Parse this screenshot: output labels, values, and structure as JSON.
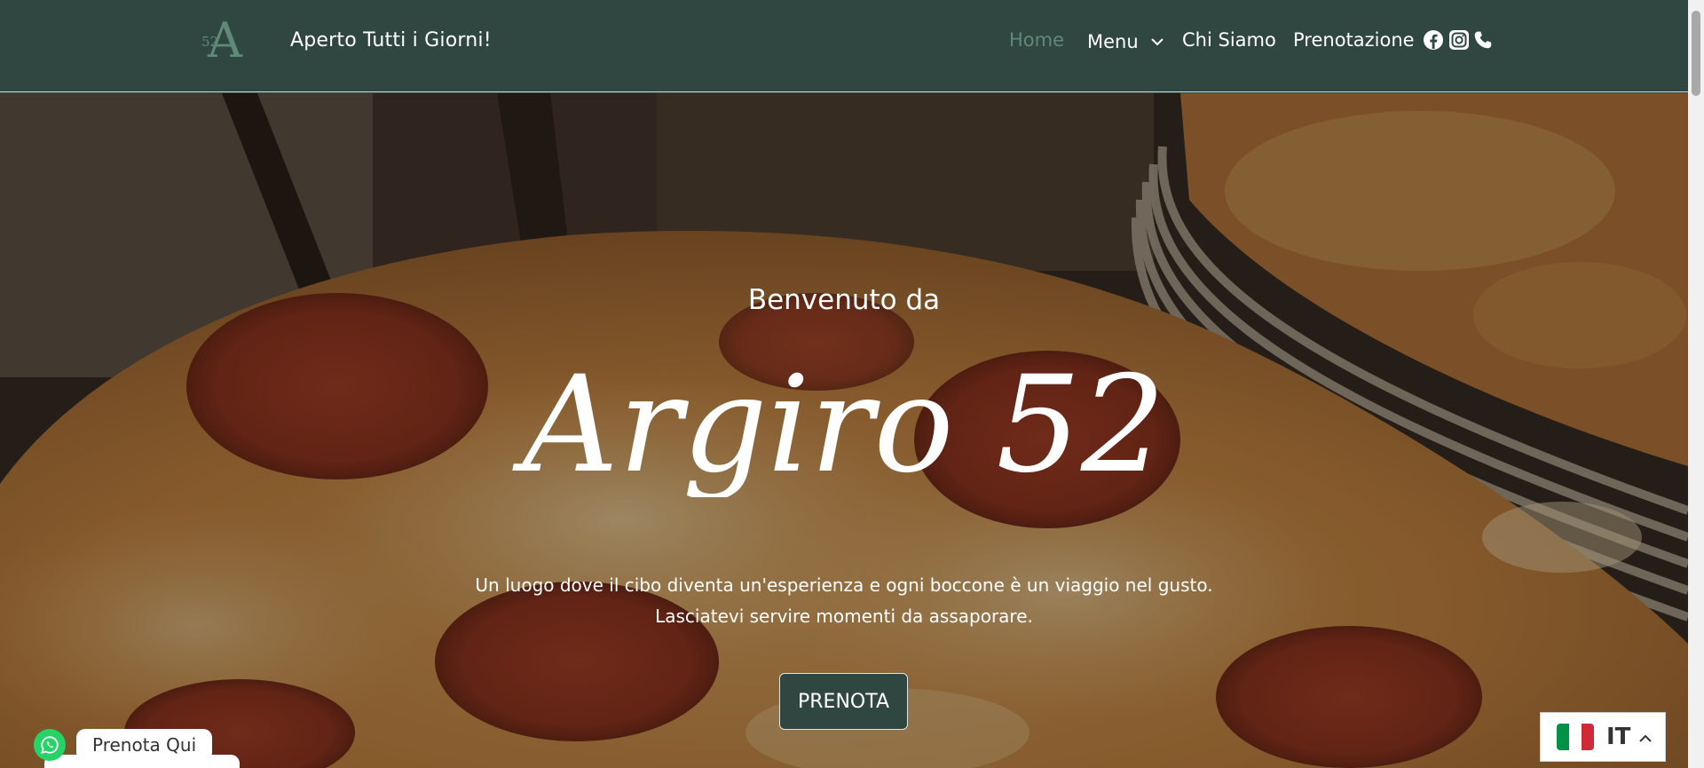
{
  "header": {
    "logo_letter": "A",
    "logo_number": "52",
    "tagline": "Aperto Tutti i Giorni!",
    "nav": [
      {
        "label": "Home",
        "active": true
      },
      {
        "label": "Menu",
        "has_dropdown": true
      },
      {
        "label": "Chi Siamo"
      },
      {
        "label": "Prenotazione"
      }
    ],
    "social_icons": [
      "facebook-icon",
      "instagram-icon",
      "phone-icon"
    ]
  },
  "hero": {
    "subtitle": "Benvenuto da",
    "title": "Argiro 52",
    "description": [
      "Un luogo dove il cibo diventa un'esperienza e ogni boccone è un viaggio nel gusto.",
      "Lasciatevi servire momenti da assaporare."
    ],
    "cta_label": "PRENOTA"
  },
  "whatsapp": {
    "label": "Prenota Qui"
  },
  "language": {
    "code": "IT",
    "flag_colors": [
      "#009246",
      "#ffffff",
      "#ce2b37"
    ]
  },
  "colors": {
    "brand": "#2f4740",
    "active_nav": "#5e8a77",
    "whatsapp": "#25d366"
  }
}
